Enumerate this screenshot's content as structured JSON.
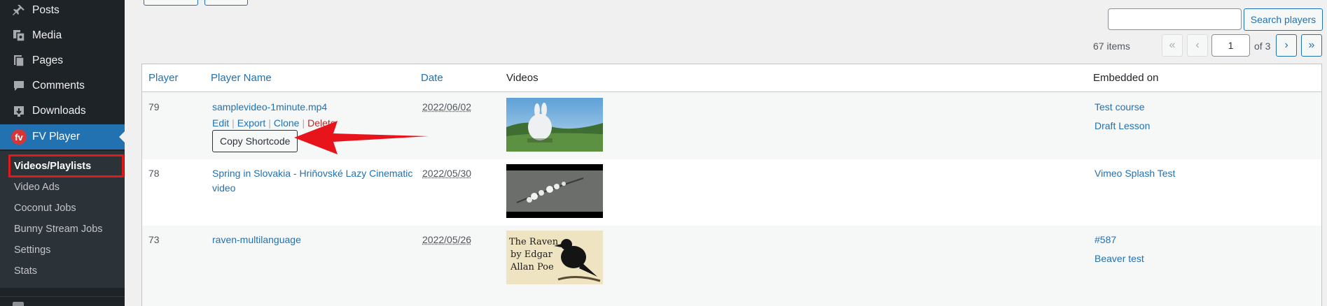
{
  "sidebar": {
    "menu": [
      {
        "label": "Posts",
        "icon": "pin-icon"
      },
      {
        "label": "Media",
        "icon": "media-icon"
      },
      {
        "label": "Pages",
        "icon": "pages-icon"
      },
      {
        "label": "Comments",
        "icon": "comment-icon"
      },
      {
        "label": "Downloads",
        "icon": "download-icon"
      },
      {
        "label": "FV Player",
        "icon": "fv-logo-icon",
        "logo_text": "fv"
      }
    ],
    "submenu": [
      "Videos/Playlists",
      "Video Ads",
      "Coconut Jobs",
      "Bunny Stream Jobs",
      "Settings",
      "Stats"
    ]
  },
  "search": {
    "placeholder": "",
    "button_label": "Search players"
  },
  "pagination": {
    "items_text": "67 items",
    "first": "«",
    "prev": "‹",
    "current_page": "1",
    "of_text": "of 3",
    "next": "›",
    "last": "»"
  },
  "table": {
    "headers": {
      "player": "Player",
      "player_name": "Player Name",
      "date": "Date",
      "videos": "Videos",
      "embedded_on": "Embedded on"
    },
    "rows": [
      {
        "id": "79",
        "name": "samplevideo-1minute.mp4",
        "actions": {
          "edit": "Edit",
          "export": "Export",
          "clone": "Clone",
          "delete": "Delete"
        },
        "copy_button": "Copy Shortcode",
        "date": "2022/06/02",
        "embedded": [
          "Test course",
          "Draft Lesson"
        ]
      },
      {
        "id": "78",
        "name_line1": "Spring in Slovakia - Hriňovské Lazy Cinematic",
        "name_line2": "video",
        "date": "2022/05/30",
        "embedded": [
          "Vimeo Splash Test"
        ]
      },
      {
        "id": "73",
        "name": "raven-multilanguage",
        "date": "2022/05/26",
        "thumb_text": [
          "The Raven",
          "by Edgar",
          "Allan Poe"
        ],
        "embedded": [
          "#587",
          "Beaver test"
        ]
      }
    ]
  },
  "colors": {
    "accent": "#2271b1",
    "sidebar": "#1d2327",
    "highlight": "#e01a1a",
    "arrow": "#e8141b"
  }
}
